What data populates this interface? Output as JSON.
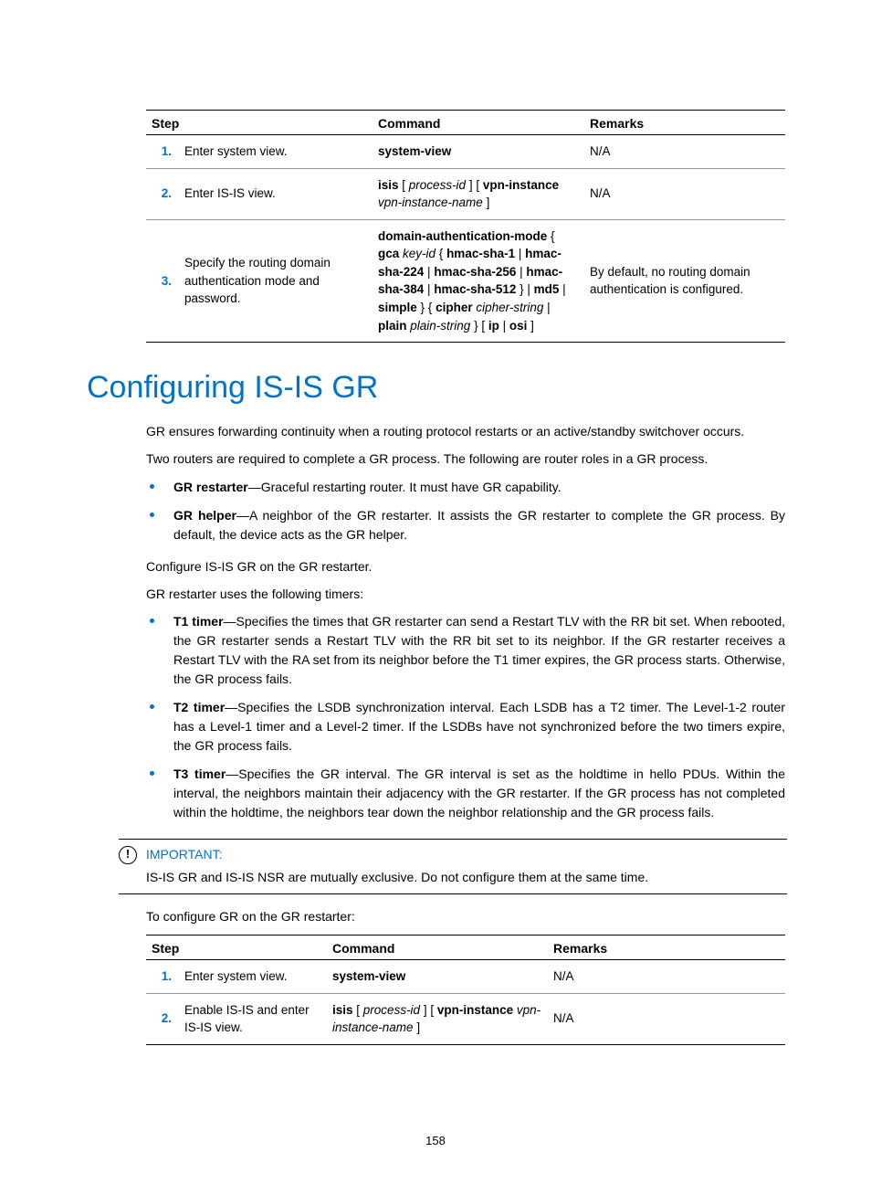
{
  "table1": {
    "headers": {
      "step": "Step",
      "command": "Command",
      "remarks": "Remarks"
    },
    "rows": [
      {
        "num": "1.",
        "step": "Enter system view.",
        "cmd_bold1": "system-view",
        "remarks": "N/A"
      },
      {
        "num": "2.",
        "step": "Enter IS-IS view.",
        "cmd_b1": "isis",
        "cmd_i1": "process-id",
        "cmd_b2": "vpn-instance",
        "cmd_i2": "vpn-instance-name",
        "remarks": "N/A"
      },
      {
        "num": "3.",
        "step": "Specify the routing domain authentication mode and password.",
        "cmd_b1": "domain-authentication-mode",
        "cmd_b2": "gca",
        "cmd_i1": "key-id",
        "cmd_b3": "hmac-sha-1",
        "cmd_b4": "hmac-sha-224",
        "cmd_b5": "hmac-sha-256",
        "cmd_b6": "hmac-sha-384",
        "cmd_b7": "hmac-sha-512",
        "cmd_b8": "md5",
        "cmd_b9": "simple",
        "cmd_b10": "cipher",
        "cmd_i2": "cipher-string",
        "cmd_b11": "plain",
        "cmd_i3": "plain-string",
        "cmd_b12": "ip",
        "cmd_b13": "osi",
        "remarks": "By default, no routing domain authentication is configured."
      }
    ]
  },
  "heading": "Configuring IS-IS GR",
  "para1": "GR ensures forwarding continuity when a routing protocol restarts or an active/standby switchover occurs.",
  "para2": "Two routers are required to complete a GR process. The following are router roles in a GR process.",
  "bullets1": [
    {
      "b": "GR restarter",
      "t": "—Graceful restarting router. It must have GR capability."
    },
    {
      "b": "GR helper",
      "t": "—A neighbor of the GR restarter. It assists the GR restarter to complete the GR process. By default, the device acts as the GR helper."
    }
  ],
  "para3": "Configure IS-IS GR on the GR restarter.",
  "para4": "GR restarter uses the following timers:",
  "bullets2": [
    {
      "b": "T1 timer",
      "t": "—Specifies the times that GR restarter can send a Restart TLV with the RR bit set. When rebooted, the GR restarter sends a Restart TLV with the RR bit set to its neighbor. If the GR restarter receives a Restart TLV with the RA set from its neighbor before the T1 timer expires, the GR process starts. Otherwise, the GR process fails."
    },
    {
      "b": "T2 timer",
      "t": "—Specifies the LSDB synchronization interval. Each LSDB has a T2 timer. The Level-1-2 router has a Level-1 timer and a Level-2 timer. If the LSDBs have not synchronized before the two timers expire, the GR process fails."
    },
    {
      "b": "T3 timer",
      "t": "—Specifies the GR interval. The GR interval is set as the holdtime in hello PDUs. Within the interval, the neighbors maintain their adjacency with the GR restarter. If the GR process has not completed within the holdtime, the neighbors tear down the neighbor relationship and the GR process fails."
    }
  ],
  "important": {
    "label": "IMPORTANT:",
    "text": "IS-IS GR and IS-IS NSR are mutually exclusive. Do not configure them at the same time."
  },
  "para5": "To configure GR on the GR restarter:",
  "table2": {
    "headers": {
      "step": "Step",
      "command": "Command",
      "remarks": "Remarks"
    },
    "rows": [
      {
        "num": "1.",
        "step": "Enter system view.",
        "cmd_bold1": "system-view",
        "remarks": "N/A"
      },
      {
        "num": "2.",
        "step": "Enable IS-IS and enter IS-IS view.",
        "cmd_b1": "isis",
        "cmd_i1": "process-id",
        "cmd_b2": "vpn-instance",
        "cmd_i2": "vpn-instance-name",
        "remarks": "N/A"
      }
    ]
  },
  "page_number": "158"
}
